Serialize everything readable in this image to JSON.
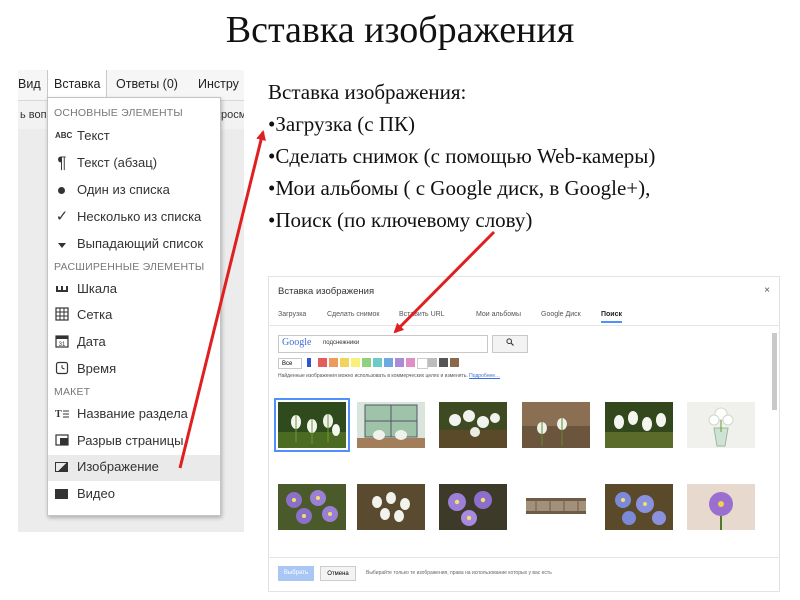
{
  "slide": {
    "title": "Вставка изображения"
  },
  "menubar": {
    "items": [
      {
        "label": "Вид"
      },
      {
        "label": "Вставка"
      },
      {
        "label": "Ответы (0)"
      },
      {
        "label": "Инстру"
      }
    ],
    "toolbar_left": "ь вопр",
    "toolbar_right": "росм"
  },
  "insert_menu": {
    "sections": [
      {
        "header": "ОСНОВНЫЕ ЭЛЕМЕНТЫ"
      },
      {
        "header": "РАСШИРЕННЫЕ ЭЛЕМЕНТЫ"
      },
      {
        "header": "МАКЕТ"
      }
    ],
    "items": [
      {
        "label": "Текст",
        "icon": "abc-icon"
      },
      {
        "label": "Текст (абзац)",
        "icon": "paragraph-icon"
      },
      {
        "label": "Один из списка",
        "icon": "radio-icon"
      },
      {
        "label": "Несколько из списка",
        "icon": "checkmark-icon"
      },
      {
        "label": "Выпадающий список",
        "icon": "dropdown-icon"
      },
      {
        "label": "Шкала",
        "icon": "scale-icon"
      },
      {
        "label": "Сетка",
        "icon": "grid-icon"
      },
      {
        "label": "Дата",
        "icon": "calendar-icon"
      },
      {
        "label": "Время",
        "icon": "clock-icon"
      },
      {
        "label": "Название раздела",
        "icon": "section-title-icon"
      },
      {
        "label": "Разрыв страницы",
        "icon": "page-break-icon"
      },
      {
        "label": "Изображение",
        "icon": "image-icon"
      },
      {
        "label": "Видео",
        "icon": "video-icon"
      }
    ]
  },
  "bullets": {
    "heading": "Вставка изображения:",
    "items": [
      "•Загрузка (с ПК)",
      "•Сделать снимок (с помощью Web-камеры)",
      "•Мои альбомы ( с Google диск, в Google+),",
      "•Поиск (по ключевому слову)"
    ]
  },
  "dialog": {
    "title": "Вставка изображения",
    "close": "×",
    "tabs": [
      {
        "label": "Загрузка"
      },
      {
        "label": "Сделать снимок"
      },
      {
        "label": "Вставить URL"
      },
      {
        "label": "Мои альбомы"
      },
      {
        "label": "Google Диск"
      },
      {
        "label": "Поиск",
        "active": true
      }
    ],
    "search": {
      "logo": "Google",
      "query": "подснежники",
      "button_icon": "magnifier-icon"
    },
    "filter_label": "Все",
    "color_swatches": [
      "#3355cc",
      "#e35d5d",
      "#ee9a5a",
      "#f2d45c",
      "#f7f07a",
      "#8fd27e",
      "#6ec9c9",
      "#6ea8e0",
      "#a98bd8",
      "#e08fc5",
      "#ffffff",
      "#bdbdbd",
      "#555555",
      "#8a6a4a"
    ],
    "note": "Найденные изображения можно использовать в коммерческих целях и изменять.",
    "note_link": "Подробнее…",
    "footer": {
      "choose": "Выбрать",
      "cancel": "Отмена",
      "note": "Выбирайте только те изображения, права на использование которых у вас есть"
    }
  }
}
